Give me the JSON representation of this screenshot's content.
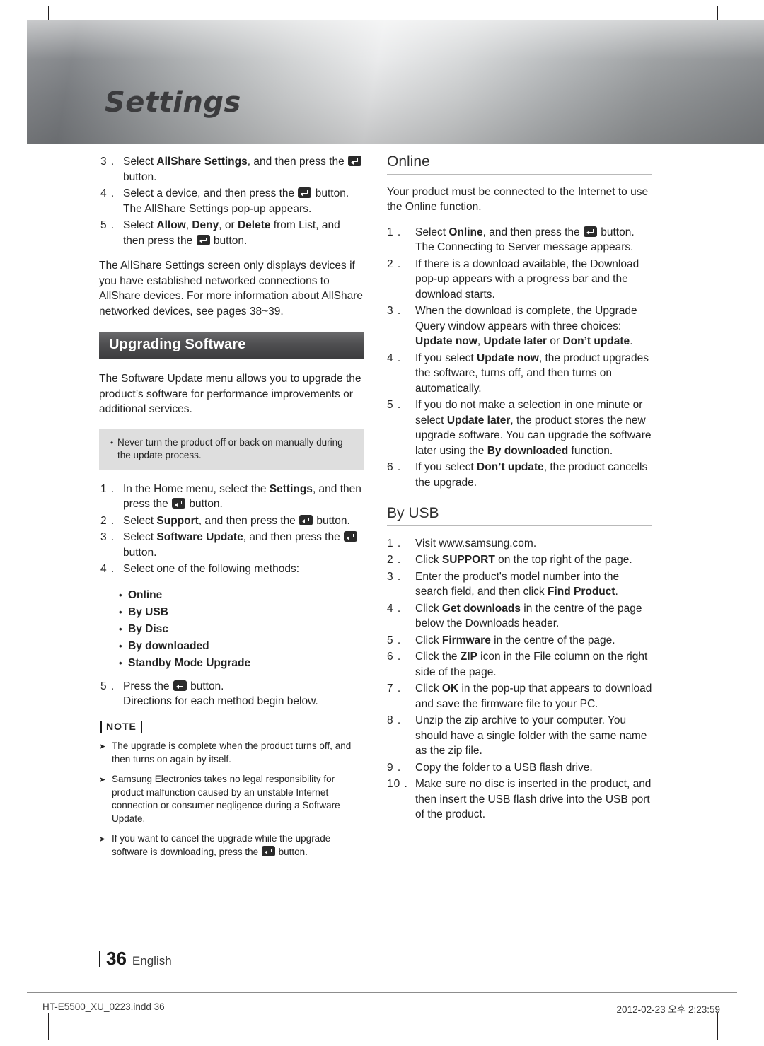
{
  "page": {
    "header_title": "Settings",
    "page_number": "36",
    "page_language": "English",
    "footer_left": "HT-E5500_XU_0223.indd   36",
    "footer_right": "2012-02-23   오후 2:23:59",
    "colors": {
      "section_bar": "#4f4f51",
      "caution_box": "#dedede",
      "text": "#232323"
    }
  },
  "left_column": {
    "allshare_steps": [
      {
        "num": "3 .",
        "parts": [
          {
            "t": "Select ",
            "b": false
          },
          {
            "t": "AllShare Settings",
            "b": true
          },
          {
            "t": ", and then press the ",
            "b": false
          },
          {
            "t": "@BTN@",
            "b": false
          },
          {
            "t": " button.",
            "b": false
          }
        ]
      },
      {
        "num": "4 .",
        "parts": [
          {
            "t": "Select a device, and then press the ",
            "b": false
          },
          {
            "t": "@BTN@",
            "b": false
          },
          {
            "t": " button. The AllShare Settings pop-up appears.",
            "b": false
          }
        ]
      },
      {
        "num": "5 .",
        "parts": [
          {
            "t": "Select ",
            "b": false
          },
          {
            "t": "Allow",
            "b": true
          },
          {
            "t": ", ",
            "b": false
          },
          {
            "t": "Deny",
            "b": true
          },
          {
            "t": ", or ",
            "b": false
          },
          {
            "t": "Delete",
            "b": true
          },
          {
            "t": " from List, and then press the ",
            "b": false
          },
          {
            "t": "@BTN@",
            "b": false
          },
          {
            "t": " button.",
            "b": false
          }
        ]
      }
    ],
    "allshare_paragraph": "The AllShare Settings screen only displays devices if you have established networked connections to AllShare devices. For more information about AllShare networked devices, see pages 38~39.",
    "section_title": "Upgrading Software",
    "intro_paragraph": "The Software Update menu allows you to upgrade the product’s software for performance improvements or additional services.",
    "caution": "Never turn the product off or back on manually during the update process.",
    "upgrade_steps": [
      {
        "num": "1 .",
        "parts": [
          {
            "t": "In the Home menu, select the ",
            "b": false
          },
          {
            "t": "Settings",
            "b": true
          },
          {
            "t": ", and then press the ",
            "b": false
          },
          {
            "t": "@BTN@",
            "b": false
          },
          {
            "t": " button.",
            "b": false
          }
        ]
      },
      {
        "num": "2 .",
        "parts": [
          {
            "t": "Select ",
            "b": false
          },
          {
            "t": "Support",
            "b": true
          },
          {
            "t": ", and then press the ",
            "b": false
          },
          {
            "t": "@BTN@",
            "b": false
          },
          {
            "t": " button.",
            "b": false
          }
        ]
      },
      {
        "num": "3 .",
        "parts": [
          {
            "t": "Select ",
            "b": false
          },
          {
            "t": "Software Update",
            "b": true
          },
          {
            "t": ", and then press the ",
            "b": false
          },
          {
            "t": "@BTN@",
            "b": false
          },
          {
            "t": " button.",
            "b": false
          }
        ]
      },
      {
        "num": "4 .",
        "parts": [
          {
            "t": "Select one of the following methods:",
            "b": false
          }
        ]
      }
    ],
    "methods": [
      "Online",
      "By USB",
      "By Disc",
      "By downloaded",
      "Standby Mode Upgrade"
    ],
    "final_step": {
      "num": "5 .",
      "parts": [
        {
          "t": "Press the ",
          "b": false
        },
        {
          "t": "@BTN@",
          "b": false
        },
        {
          "t": " button.",
          "b": false
        }
      ],
      "sub": "Directions for each method begin below."
    },
    "note_label": "NOTE",
    "notes": [
      [
        {
          "t": "The upgrade is complete when the product turns off, and then turns on again by itself.",
          "b": false
        }
      ],
      [
        {
          "t": "Samsung Electronics takes no legal responsibility for product malfunction caused by an unstable Internet connection or consumer negligence during a Software Update.",
          "b": false
        }
      ],
      [
        {
          "t": "If you want to cancel the upgrade while the upgrade software is downloading, press the ",
          "b": false
        },
        {
          "t": "@BTN@",
          "b": false
        },
        {
          "t": " button.",
          "b": false
        }
      ]
    ]
  },
  "right_column": {
    "online_heading": "Online",
    "online_intro": "Your product must be connected to the Internet to use the Online function.",
    "online_steps": [
      {
        "num": "1 .",
        "parts": [
          {
            "t": "Select ",
            "b": false
          },
          {
            "t": "Online",
            "b": true
          },
          {
            "t": ", and then press the ",
            "b": false
          },
          {
            "t": "@BTN@",
            "b": false
          },
          {
            "t": " button. The Connecting to Server message appears.",
            "b": false
          }
        ]
      },
      {
        "num": "2 .",
        "parts": [
          {
            "t": "If there is a download available, the Download pop-up appears with a progress bar and the download starts.",
            "b": false
          }
        ]
      },
      {
        "num": "3 .",
        "parts": [
          {
            "t": "When the download is complete, the Upgrade Query window appears with three choices: ",
            "b": false
          },
          {
            "t": "Update now",
            "b": true
          },
          {
            "t": ", ",
            "b": false
          },
          {
            "t": "Update later",
            "b": true
          },
          {
            "t": " or ",
            "b": false
          },
          {
            "t": "Don’t update",
            "b": true
          },
          {
            "t": ".",
            "b": false
          }
        ]
      },
      {
        "num": "4 .",
        "parts": [
          {
            "t": "If you select ",
            "b": false
          },
          {
            "t": "Update now",
            "b": true
          },
          {
            "t": ", the product upgrades the software, turns off, and then turns on automatically.",
            "b": false
          }
        ]
      },
      {
        "num": "5 .",
        "parts": [
          {
            "t": "If you do not make a selection in one minute or select ",
            "b": false
          },
          {
            "t": "Update later",
            "b": true
          },
          {
            "t": ", the product stores the new upgrade software. You can upgrade the software later using the ",
            "b": false
          },
          {
            "t": "By downloaded",
            "b": true
          },
          {
            "t": " function.",
            "b": false
          }
        ]
      },
      {
        "num": "6 .",
        "parts": [
          {
            "t": "If you select ",
            "b": false
          },
          {
            "t": "Don’t update",
            "b": true
          },
          {
            "t": ", the product cancells the upgrade.",
            "b": false
          }
        ]
      }
    ],
    "byusb_heading": "By USB",
    "byusb_steps": [
      {
        "num": "1 .",
        "parts": [
          {
            "t": "Visit www.samsung.com.",
            "b": false
          }
        ]
      },
      {
        "num": "2 .",
        "parts": [
          {
            "t": "Click ",
            "b": false
          },
          {
            "t": "SUPPORT",
            "b": true
          },
          {
            "t": " on the top right of the page.",
            "b": false
          }
        ]
      },
      {
        "num": "3 .",
        "parts": [
          {
            "t": "Enter the product's model number into the search field, and then click ",
            "b": false
          },
          {
            "t": "Find Product",
            "b": true
          },
          {
            "t": ".",
            "b": false
          }
        ]
      },
      {
        "num": "4 .",
        "parts": [
          {
            "t": "Click ",
            "b": false
          },
          {
            "t": "Get downloads",
            "b": true
          },
          {
            "t": " in the centre of the page below the Downloads header.",
            "b": false
          }
        ]
      },
      {
        "num": "5 .",
        "parts": [
          {
            "t": "Click ",
            "b": false
          },
          {
            "t": "Firmware",
            "b": true
          },
          {
            "t": " in the centre of the page.",
            "b": false
          }
        ]
      },
      {
        "num": "6 .",
        "parts": [
          {
            "t": "Click the ",
            "b": false
          },
          {
            "t": "ZIP",
            "b": true
          },
          {
            "t": " icon in the File column on the right side of the page.",
            "b": false
          }
        ]
      },
      {
        "num": "7 .",
        "parts": [
          {
            "t": "Click ",
            "b": false
          },
          {
            "t": "OK",
            "b": true
          },
          {
            "t": " in the pop-up that appears to download and save the firmware file to your PC.",
            "b": false
          }
        ]
      },
      {
        "num": "8 .",
        "parts": [
          {
            "t": "Unzip the zip archive to your computer. You should have a single folder with the same name as the zip file.",
            "b": false
          }
        ]
      },
      {
        "num": "9 .",
        "parts": [
          {
            "t": "Copy the folder to a USB flash drive.",
            "b": false
          }
        ]
      },
      {
        "num": "10 .",
        "parts": [
          {
            "t": "Make sure no disc is inserted in the product, and then insert the USB flash drive into the USB port of the product.",
            "b": false
          }
        ]
      }
    ]
  }
}
